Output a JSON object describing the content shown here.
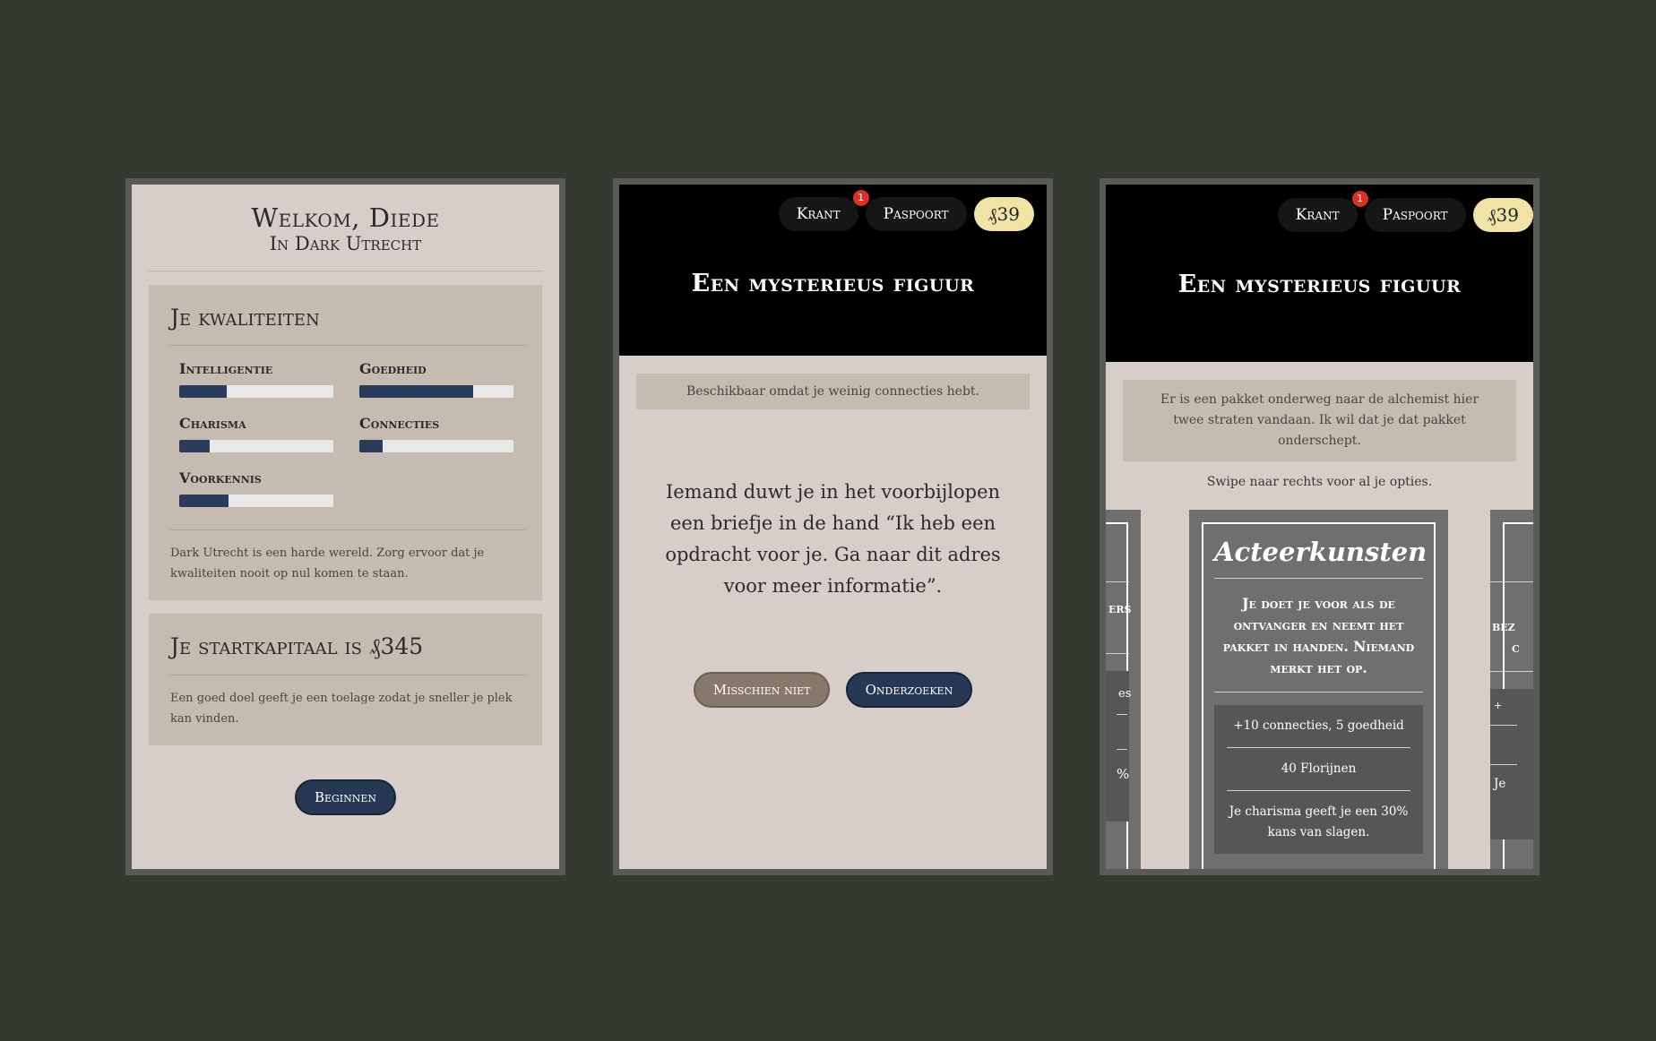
{
  "screen1": {
    "welcome_title": "Welkom, Diede",
    "welcome_subtitle": "In Dark Utrecht",
    "qualities": {
      "heading": "Je kwaliteiten",
      "items": [
        {
          "label": "Intelligentie",
          "value": 0.31
        },
        {
          "label": "Goedheid",
          "value": 0.74
        },
        {
          "label": "Charisma",
          "value": 0.2
        },
        {
          "label": "Connecties",
          "value": 0.15
        },
        {
          "label": "Voorkennis",
          "value": 0.32
        }
      ],
      "note": "Dark Utrecht is een harde wereld. Zorg ervoor dat je kwaliteiten nooit op nul komen te staan."
    },
    "capital": {
      "heading": "Je startkapitaal is ₰345",
      "note": "Een goed doel geeft je een toelage zodat je sneller je plek kan vinden."
    },
    "start_button": "Beginnen"
  },
  "screen2": {
    "nav": {
      "krant": "Krant",
      "krant_badge": "1",
      "paspoort": "Paspoort",
      "money": "₰39"
    },
    "title": "Een mysterieus figuur",
    "availability": "Beschikbaar omdat je weinig connecties hebt.",
    "story": "Iemand duwt je in het voorbijlopen een briefje in de hand “Ik heb een opdracht voor je. Ga naar dit adres voor meer informatie”.",
    "decline_button": "Misschien niet",
    "accept_button": "Onderzoeken"
  },
  "screen3": {
    "nav": {
      "krant": "Krant",
      "krant_badge": "1",
      "paspoort": "Paspoort",
      "money": "₰39"
    },
    "title": "Een mysterieus figuur",
    "info": "Er is een pakket onderweg naar de alchemist hier twee straten vandaan. Ik wil dat je dat pakket onderschept.",
    "swipe_hint": "Swipe naar rechts voor al je opties.",
    "card": {
      "title": "Acteerkunsten",
      "description": "Je doet je voor als de ontvanger en neemt het pakket in handen. Niemand merkt het op.",
      "stats": [
        "+10 connecties, 5 goedheid",
        "40 Florijnen",
        "Je charisma geeft je een 30% kans van slagen."
      ]
    },
    "left_card": {
      "fragment_title": "ers",
      "fragment_stat1": "es",
      "fragment_stat2": "%"
    },
    "right_card": {
      "fragment_title": "bez",
      "fragment_title2": "c",
      "fragment_stat1": "+",
      "fragment_stat2": "Je"
    }
  }
}
